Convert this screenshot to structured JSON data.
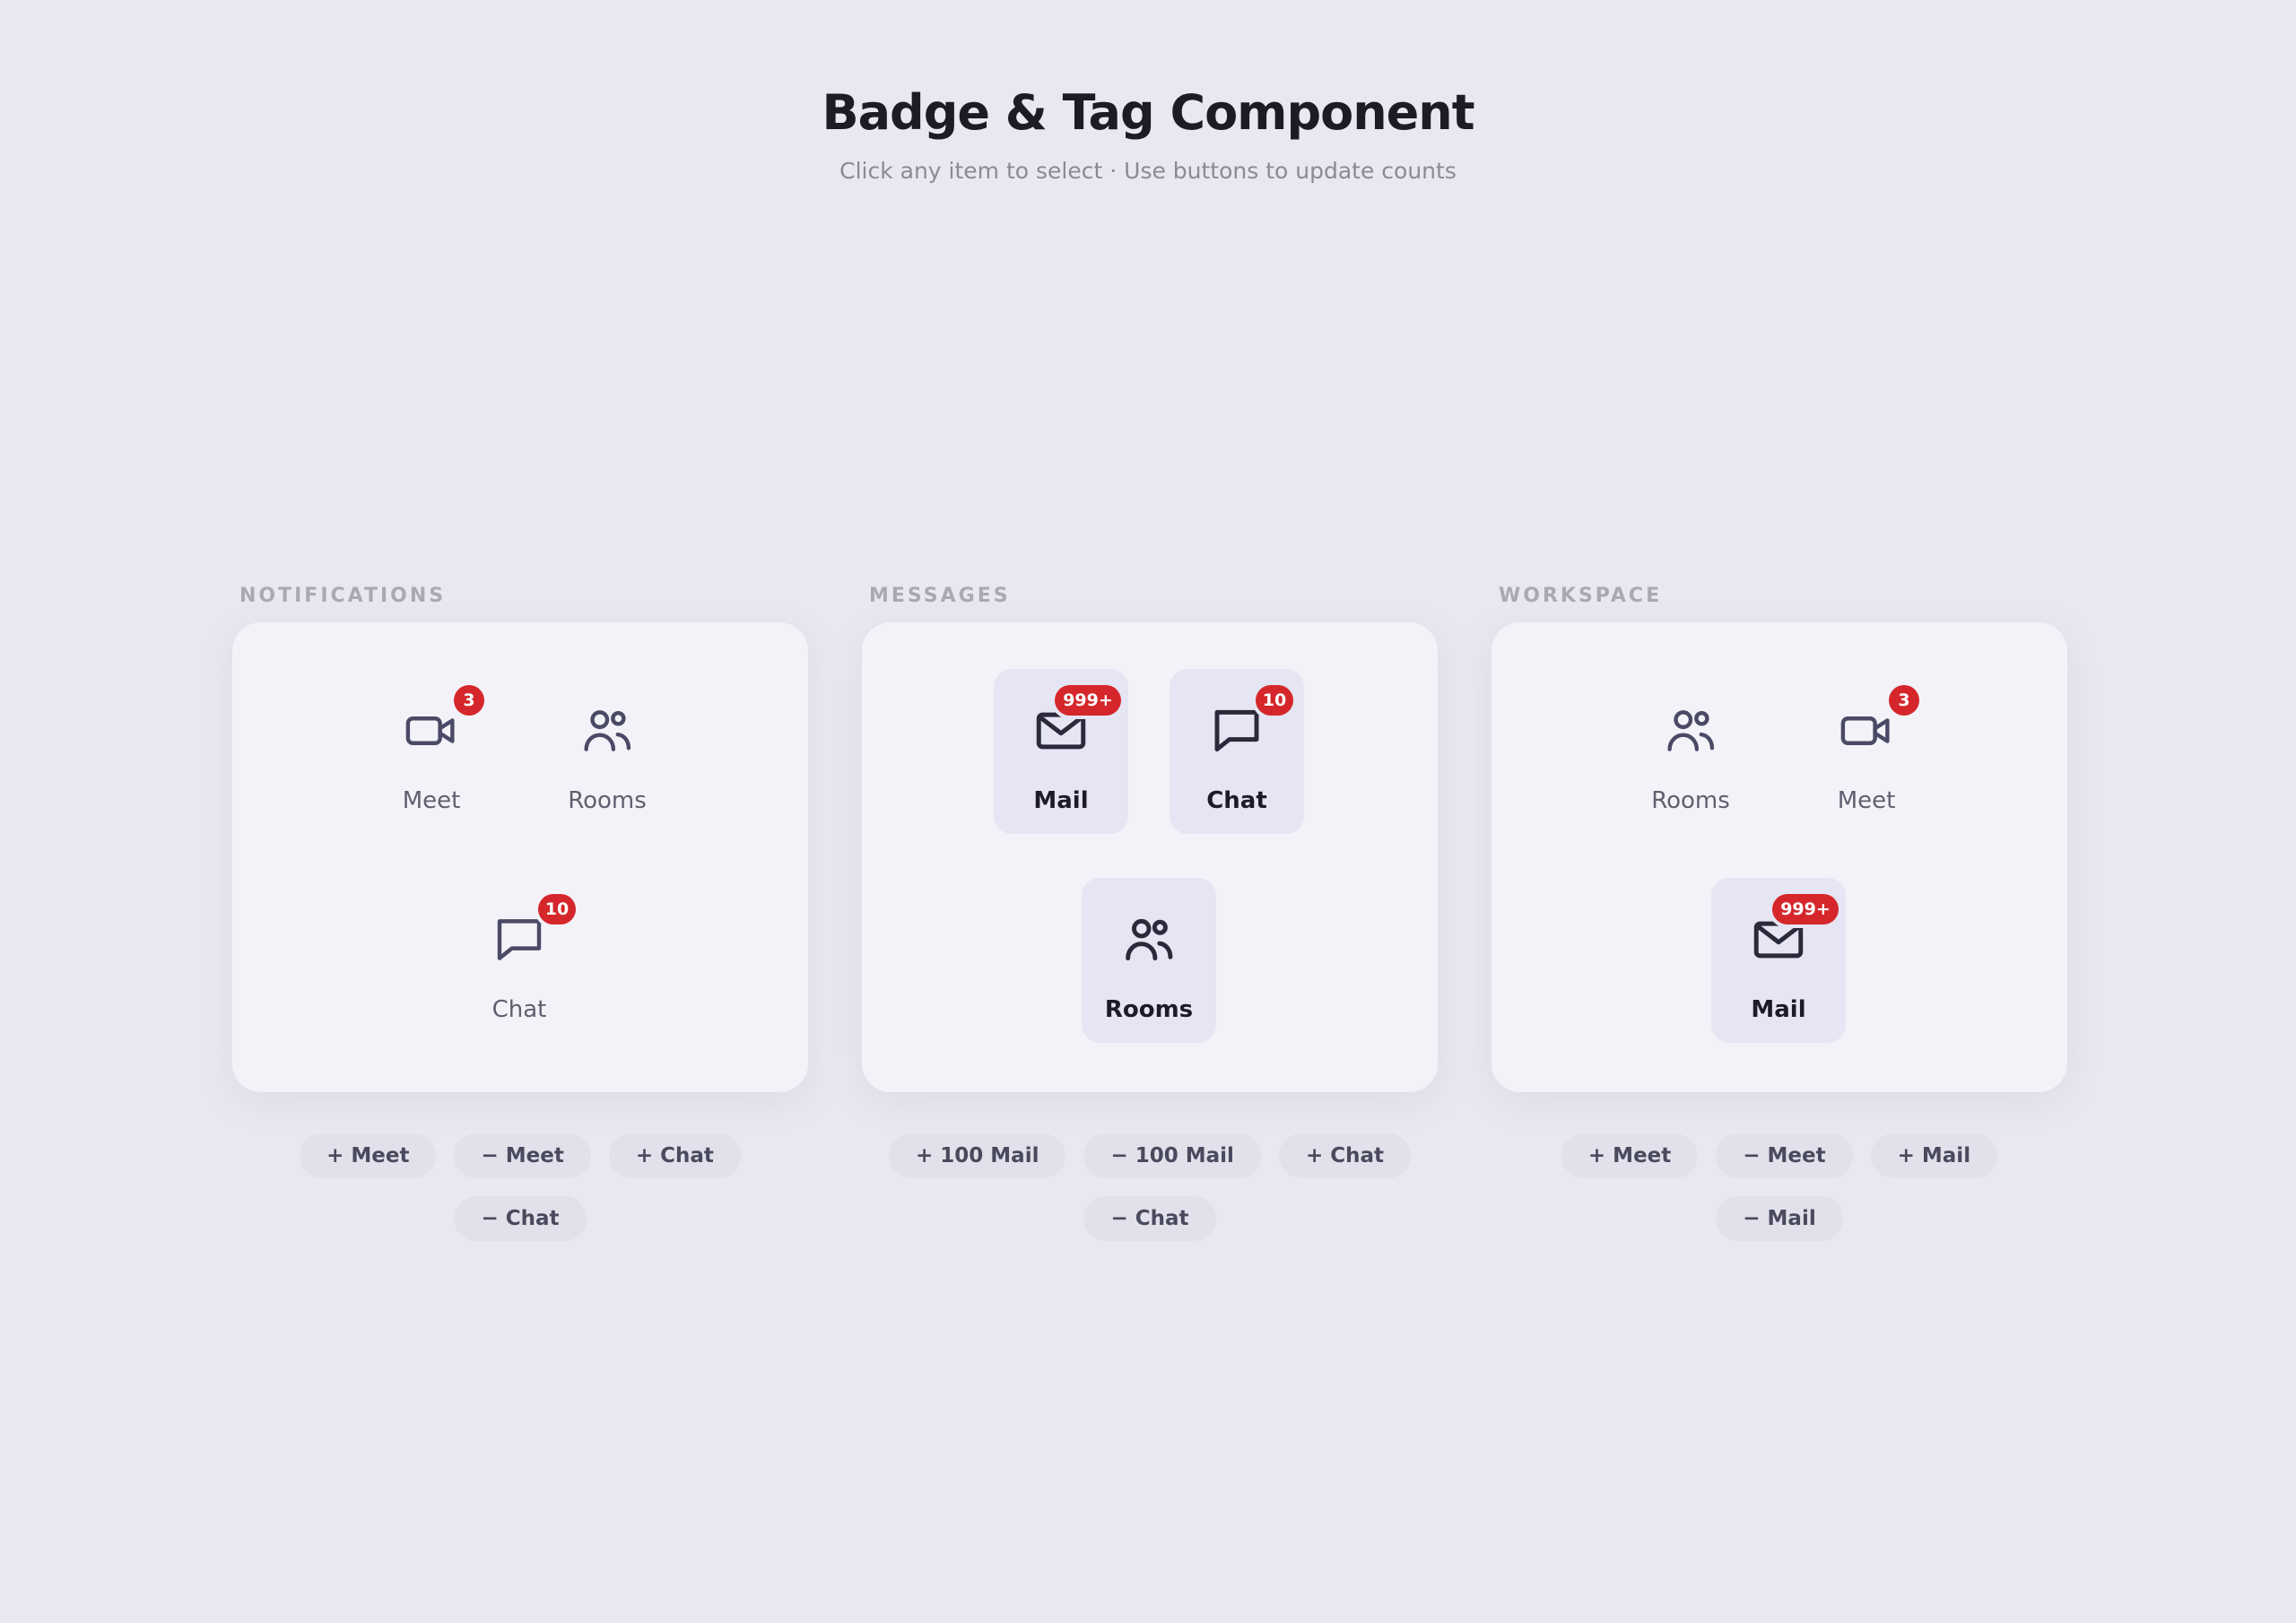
{
  "page": {
    "title": "Badge & Tag Component",
    "subtitle": "Click any item to select · Use buttons to update counts"
  },
  "colors": {
    "badge": "#d5272b",
    "background": "#e8e8f0",
    "card": "#f3f2f8",
    "selected": "#e6e5f3"
  },
  "groups": [
    {
      "label": "NOTIFICATIONS",
      "items": [
        {
          "label": "Meet",
          "icon": "video-icon",
          "badge": "3",
          "selected": false
        },
        {
          "label": "Rooms",
          "icon": "people-icon",
          "badge": "",
          "selected": false
        },
        {
          "label": "Chat",
          "icon": "chat-icon",
          "badge": "10",
          "selected": false
        }
      ],
      "buttons": [
        "+ Meet",
        "− Meet",
        "+ Chat",
        "− Chat"
      ]
    },
    {
      "label": "MESSAGES",
      "items": [
        {
          "label": "Mail",
          "icon": "mail-icon",
          "badge": "999+",
          "selected": true
        },
        {
          "label": "Chat",
          "icon": "chat-icon",
          "badge": "10",
          "selected": true
        },
        {
          "label": "Rooms",
          "icon": "people-icon",
          "badge": "",
          "selected": true
        }
      ],
      "buttons": [
        "+ 100 Mail",
        "− 100 Mail",
        "+ Chat",
        "− Chat"
      ]
    },
    {
      "label": "WORKSPACE",
      "items": [
        {
          "label": "Rooms",
          "icon": "people-icon",
          "badge": "",
          "selected": false
        },
        {
          "label": "Meet",
          "icon": "video-icon",
          "badge": "3",
          "selected": false
        },
        {
          "label": "Mail",
          "icon": "mail-icon",
          "badge": "999+",
          "selected": true
        }
      ],
      "buttons": [
        "+ Meet",
        "− Meet",
        "+ Mail",
        "− Mail"
      ]
    }
  ]
}
